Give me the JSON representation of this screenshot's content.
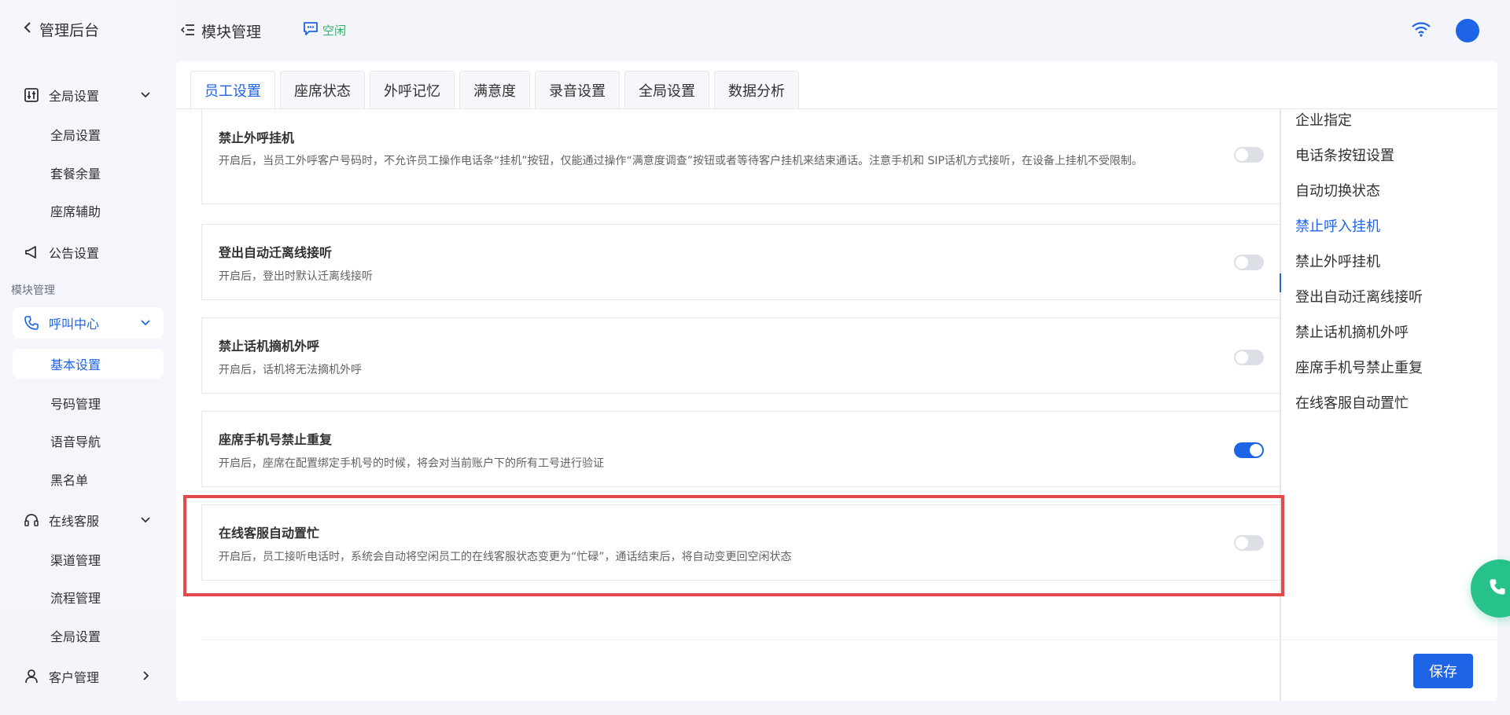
{
  "app": {
    "back_label": "管理后台"
  },
  "header": {
    "title": "模块管理",
    "status": "空闲"
  },
  "sidebar": {
    "section_label": "模块管理",
    "groups": [
      {
        "label": "全局设置",
        "children": [
          "全局设置",
          "套餐余量",
          "座席辅助"
        ]
      },
      {
        "label": "公告设置"
      },
      {
        "label": "呼叫中心",
        "children": [
          "基本设置",
          "号码管理",
          "语音导航",
          "黑名单"
        ]
      },
      {
        "label": "在线客服",
        "children": [
          "渠道管理",
          "流程管理",
          "全局设置"
        ]
      },
      {
        "label": "客户管理"
      }
    ]
  },
  "tabs": [
    "员工设置",
    "座席状态",
    "外呼记忆",
    "满意度",
    "录音设置",
    "全局设置",
    "数据分析"
  ],
  "active_tab": "员工设置",
  "settings": [
    {
      "title": "禁止外呼挂机",
      "desc": "开启后，当员工外呼客户号码时，不允许员工操作电话条“挂机”按钮，仅能通过操作“满意度调查”按钮或者等待客户挂机来结束通话。注意手机和 SIP话机方式接听，在设备上挂机不受限制。",
      "enabled": false
    },
    {
      "title": "登出自动迁离线接听",
      "desc": "开启后，登出时默认迁离线接听",
      "enabled": false
    },
    {
      "title": "禁止话机摘机外呼",
      "desc": "开启后，话机将无法摘机外呼",
      "enabled": false
    },
    {
      "title": "座席手机号禁止重复",
      "desc": "开启后，座席在配置绑定手机号的时候，将会对当前账户下的所有工号进行验证",
      "enabled": true
    },
    {
      "title": "在线客服自动置忙",
      "desc": "开启后，员工接听电话时，系统会自动将空闲员工的在线客服状态变更为“忙碌”，通话结束后，将自动变更回空闲状态",
      "enabled": false
    }
  ],
  "anchors": [
    "企业指定",
    "电话条按钮设置",
    "自动切换状态",
    "禁止呼入挂机",
    "禁止外呼挂机",
    "登出自动迁离线接听",
    "禁止话机摘机外呼",
    "座席手机号禁止重复",
    "在线客服自动置忙"
  ],
  "active_anchor": "禁止呼入挂机",
  "actions": {
    "save_label": "保存"
  },
  "colors": {
    "accent": "#1d64e6",
    "highlight": "#e5484d",
    "status": "#2db36a",
    "fab": "#26c28a"
  }
}
